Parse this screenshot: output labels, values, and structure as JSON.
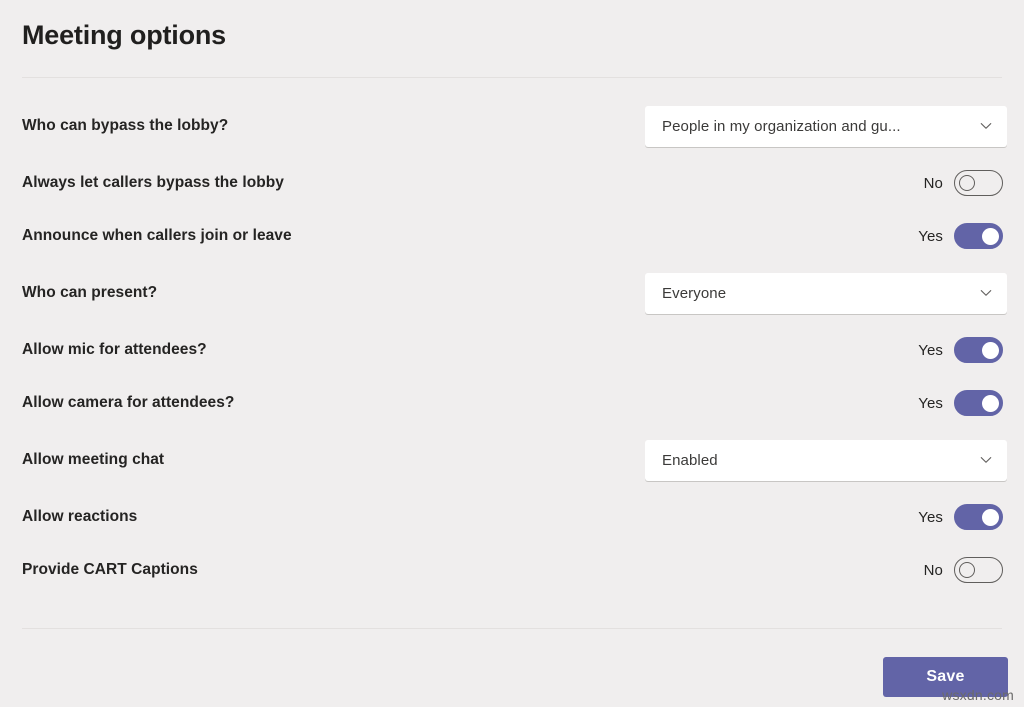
{
  "header": {
    "title": "Meeting options"
  },
  "rows": [
    {
      "label": "Who can bypass the lobby?",
      "control": "dropdown",
      "value": "People in my organization and gu...",
      "icon": "chevron-down-icon",
      "name": "who-can-bypass-lobby"
    },
    {
      "label": "Always let callers bypass the lobby",
      "control": "toggle",
      "value": "No",
      "state": "off",
      "name": "always-let-callers-bypass-lobby"
    },
    {
      "label": "Announce when callers join or leave",
      "control": "toggle",
      "value": "Yes",
      "state": "on",
      "name": "announce-callers-join-leave"
    },
    {
      "label": "Who can present?",
      "control": "dropdown",
      "value": "Everyone",
      "icon": "chevron-down-icon",
      "name": "who-can-present"
    },
    {
      "label": "Allow mic for attendees?",
      "control": "toggle",
      "value": "Yes",
      "state": "on",
      "name": "allow-mic-for-attendees"
    },
    {
      "label": "Allow camera for attendees?",
      "control": "toggle",
      "value": "Yes",
      "state": "on",
      "name": "allow-camera-for-attendees"
    },
    {
      "label": "Allow meeting chat",
      "control": "dropdown",
      "value": "Enabled",
      "icon": "chevron-down-icon",
      "name": "allow-meeting-chat"
    },
    {
      "label": "Allow reactions",
      "control": "toggle",
      "value": "Yes",
      "state": "on",
      "name": "allow-reactions"
    },
    {
      "label": "Provide CART Captions",
      "control": "toggle",
      "value": "No",
      "state": "off",
      "name": "provide-cart-captions"
    }
  ],
  "footer": {
    "save_label": "Save"
  },
  "watermark": {
    "text": "wsxdn.com"
  },
  "colors": {
    "accent": "#6264a7",
    "background": "#f0eeee",
    "text": "#252423",
    "divider": "#e3e0df",
    "control_background": "#ffffff"
  },
  "layout": {
    "row_tops": [
      104,
      161,
      214,
      271,
      328,
      381,
      438,
      495,
      548
    ]
  }
}
